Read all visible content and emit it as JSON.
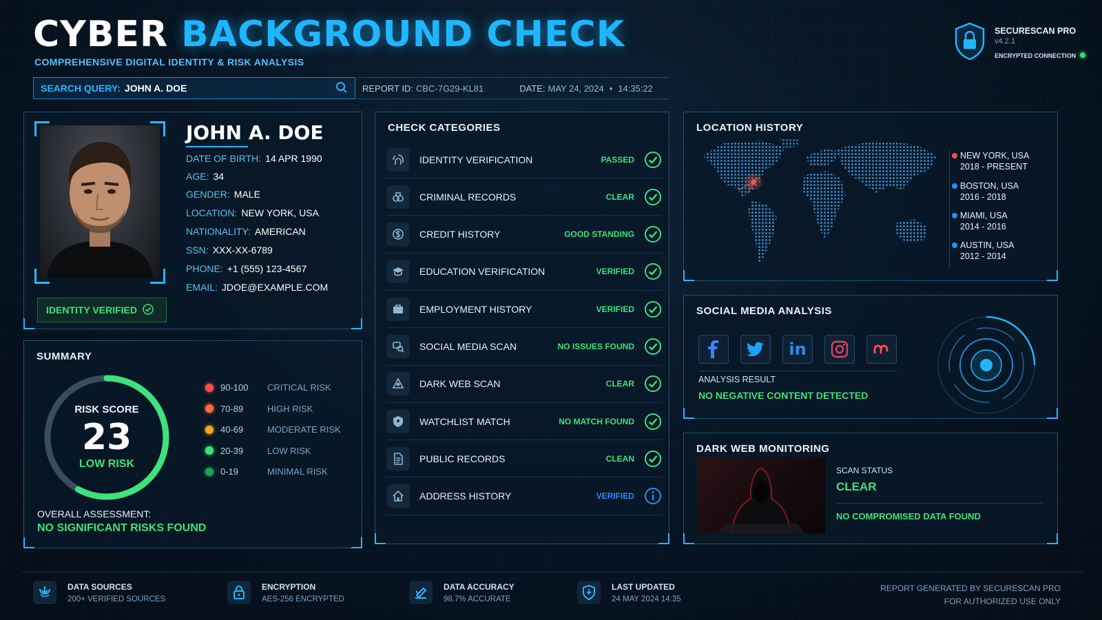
{
  "header": {
    "title_part1": "CYBER",
    "title_part2": "BACKGROUND CHECK",
    "subtitle": "COMPREHENSIVE DIGITAL IDENTITY & RISK ANALYSIS"
  },
  "search": {
    "label": "SEARCH QUERY:",
    "value": "JOHN A. DOE",
    "icon": "search-icon"
  },
  "report": {
    "id_label": "REPORT ID:",
    "id_value": "CBC-7G29-KL81",
    "date_label": "DATE:",
    "date_value": "MAY 24, 2024",
    "time_value": "14:35:22"
  },
  "brand": {
    "name": "SECURESCAN PRO",
    "version": "v4.2.1",
    "connection": "ENCRYPTED CONNECTION",
    "icon": "shield-lock-icon"
  },
  "profile": {
    "name": "JOHN A. DOE",
    "badge": "IDENTITY VERIFIED",
    "fields": [
      {
        "key": "DATE OF BIRTH:",
        "value": "14 APR 1990"
      },
      {
        "key": "AGE:",
        "value": "34"
      },
      {
        "key": "GENDER:",
        "value": "MALE"
      },
      {
        "key": "LOCATION:",
        "value": "NEW YORK, USA"
      },
      {
        "key": "NATIONALITY:",
        "value": "AMERICAN"
      },
      {
        "key": "SSN:",
        "value": "XXX-XX-6789"
      },
      {
        "key": "PHONE:",
        "value": "+1 (555) 123-4567"
      },
      {
        "key": "EMAIL:",
        "value": "JDOE@EXAMPLE.COM"
      }
    ]
  },
  "summary": {
    "title": "SUMMARY",
    "risk_label": "RISK SCORE",
    "risk_score": "23",
    "risk_level": "LOW RISK",
    "risk_score_max": 100,
    "assessment_label": "OVERALL ASSESSMENT:",
    "assessment_value": "NO SIGNIFICANT RISKS FOUND",
    "legend": [
      {
        "range": "90-100",
        "name": "CRITICAL RISK",
        "color": "#ff4b4b"
      },
      {
        "range": "70-89",
        "name": "HIGH RISK",
        "color": "#ff6a3a"
      },
      {
        "range": "40-69",
        "name": "MODERATE RISK",
        "color": "#f5a623"
      },
      {
        "range": "20-39",
        "name": "LOW RISK",
        "color": "#3ee27a"
      },
      {
        "range": "0-19",
        "name": "MINIMAL RISK",
        "color": "#1fa05a"
      }
    ]
  },
  "checks": {
    "title": "CHECK CATEGORIES",
    "items": [
      {
        "name": "IDENTITY VERIFICATION",
        "status": "PASSED",
        "icon": "fingerprint-icon",
        "state": "ok"
      },
      {
        "name": "CRIMINAL RECORDS",
        "status": "CLEAR",
        "icon": "handcuffs-icon",
        "state": "ok"
      },
      {
        "name": "CREDIT HISTORY",
        "status": "GOOD STANDING",
        "icon": "dollar-icon",
        "state": "ok"
      },
      {
        "name": "EDUCATION VERIFICATION",
        "status": "VERIFIED",
        "icon": "graduation-cap-icon",
        "state": "ok"
      },
      {
        "name": "EMPLOYMENT HISTORY",
        "status": "VERIFIED",
        "icon": "briefcase-icon",
        "state": "ok"
      },
      {
        "name": "SOCIAL MEDIA SCAN",
        "status": "NO ISSUES FOUND",
        "icon": "social-scan-icon",
        "state": "ok"
      },
      {
        "name": "DARK WEB SCAN",
        "status": "CLEAR",
        "icon": "spider-icon",
        "state": "ok"
      },
      {
        "name": "WATCHLIST MATCH",
        "status": "NO MATCH FOUND",
        "icon": "badge-icon",
        "state": "ok"
      },
      {
        "name": "PUBLIC RECORDS",
        "status": "CLEAN",
        "icon": "document-icon",
        "state": "ok"
      },
      {
        "name": "ADDRESS HISTORY",
        "status": "VERIFIED",
        "icon": "house-icon",
        "state": "info"
      }
    ]
  },
  "location": {
    "title": "LOCATION HISTORY",
    "items": [
      {
        "city": "NEW YORK, USA",
        "years": "2018 - PRESENT",
        "color": "#ff4b4b"
      },
      {
        "city": "BOSTON, USA",
        "years": "2016 - 2018",
        "color": "#2b8cff"
      },
      {
        "city": "MIAMI, USA",
        "years": "2014 - 2016",
        "color": "#2b8cff"
      },
      {
        "city": "AUSTIN, USA",
        "years": "2012 - 2014",
        "color": "#2b8cff"
      }
    ]
  },
  "social": {
    "title": "SOCIAL MEDIA ANALYSIS",
    "platforms": [
      "facebook-icon",
      "twitter-icon",
      "linkedin-icon",
      "instagram-icon",
      "other-social-icon"
    ],
    "result_label": "ANALYSIS RESULT",
    "result_value": "NO NEGATIVE CONTENT DETECTED"
  },
  "darkweb": {
    "title": "DARK WEB MONITORING",
    "status_label": "SCAN STATUS",
    "status_value": "CLEAR",
    "note": "NO COMPROMISED DATA FOUND"
  },
  "footer": {
    "items": [
      {
        "title": "DATA SOURCES",
        "sub": "200+ VERIFIED SOURCES",
        "icon": "database-icon"
      },
      {
        "title": "ENCRYPTION",
        "sub": "AES-256 ENCRYPTED",
        "icon": "lock-icon"
      },
      {
        "title": "DATA ACCURACY",
        "sub": "98.7% ACCURATE",
        "icon": "check-edit-icon"
      },
      {
        "title": "LAST UPDATED",
        "sub": "24 MAY 2024 14:35",
        "icon": "shield-icon"
      }
    ],
    "right_line1": "REPORT GENERATED BY SECURESCAN PRO",
    "right_line2": "FOR AUTHORIZED USE ONLY"
  },
  "colors": {
    "accent": "#1fb6ff",
    "success": "#3ee27a",
    "info": "#2b8cff",
    "danger": "#ff4b4b"
  }
}
